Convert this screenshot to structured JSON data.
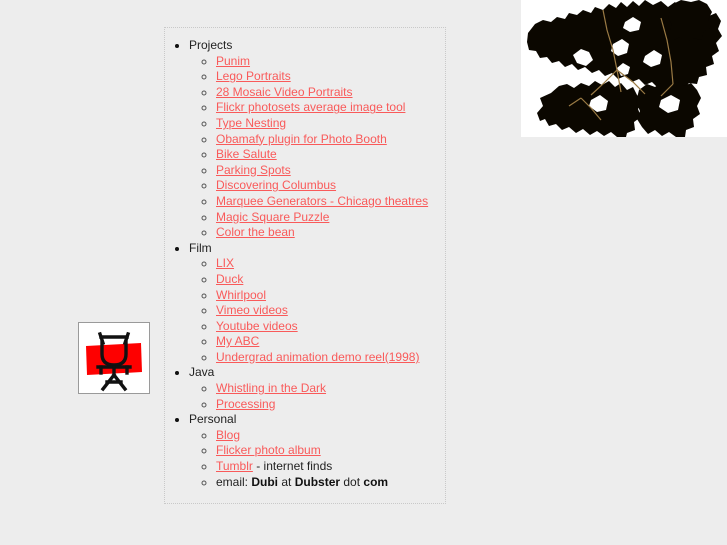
{
  "page": {
    "background_color": "#ededed",
    "link_color": "#f95a5a",
    "text_color": "#222222"
  },
  "foliage_image": {
    "name": "black-foliage-silhouette",
    "alt": "high contrast black silhouette of leaves",
    "background_color": "#ffffff",
    "shape_color": "#0b0700"
  },
  "logo_image": {
    "name": "stick-figure-logo",
    "alt": "stick figure over red rectangle",
    "background_color": "#ffffff",
    "accent_color": "#fe0000",
    "stroke_color": "#111111",
    "border_color": "#9a9a9a"
  },
  "nav": {
    "groups": [
      {
        "label": "Projects",
        "items": [
          {
            "label": "Punim",
            "type": "link"
          },
          {
            "label": "Lego Portraits",
            "type": "link"
          },
          {
            "label": "28 Mosaic Video Portraits",
            "type": "link"
          },
          {
            "label": "Flickr photosets average image tool",
            "type": "link"
          },
          {
            "label": "Type Nesting",
            "type": "link"
          },
          {
            "label": "Obamafy plugin for Photo Booth",
            "type": "link"
          },
          {
            "label": "Bike Salute",
            "type": "link"
          },
          {
            "label": "Parking Spots",
            "type": "link"
          },
          {
            "label": "Discovering Columbus",
            "type": "link"
          },
          {
            "label": "Marquee Generators - Chicago theatres",
            "type": "link"
          },
          {
            "label": "Magic Square Puzzle",
            "type": "link"
          },
          {
            "label": "Color the bean",
            "type": "link"
          }
        ]
      },
      {
        "label": "Film",
        "items": [
          {
            "label": "LIX",
            "type": "link"
          },
          {
            "label": "Duck",
            "type": "link"
          },
          {
            "label": "Whirlpool",
            "type": "link"
          },
          {
            "label": "Vimeo videos",
            "type": "link"
          },
          {
            "label": "Youtube videos",
            "type": "link"
          },
          {
            "label": "My ABC",
            "type": "link"
          },
          {
            "label": "Undergrad animation demo reel(1998)",
            "type": "link"
          }
        ]
      },
      {
        "label": "Java",
        "items": [
          {
            "label": "Whistling in the Dark",
            "type": "link"
          },
          {
            "label": "Processing",
            "type": "link"
          }
        ]
      },
      {
        "label": "Personal",
        "items": [
          {
            "label": "Blog",
            "type": "link"
          },
          {
            "label": "Flicker photo album",
            "type": "link"
          },
          {
            "label": "Tumblr",
            "type": "link",
            "suffix": " - internet finds"
          },
          {
            "type": "email",
            "prefix": "email: ",
            "user": "Dubi",
            "mid": " at ",
            "domain": "Dubster",
            "dot": " dot ",
            "tld": "com"
          }
        ]
      }
    ]
  }
}
